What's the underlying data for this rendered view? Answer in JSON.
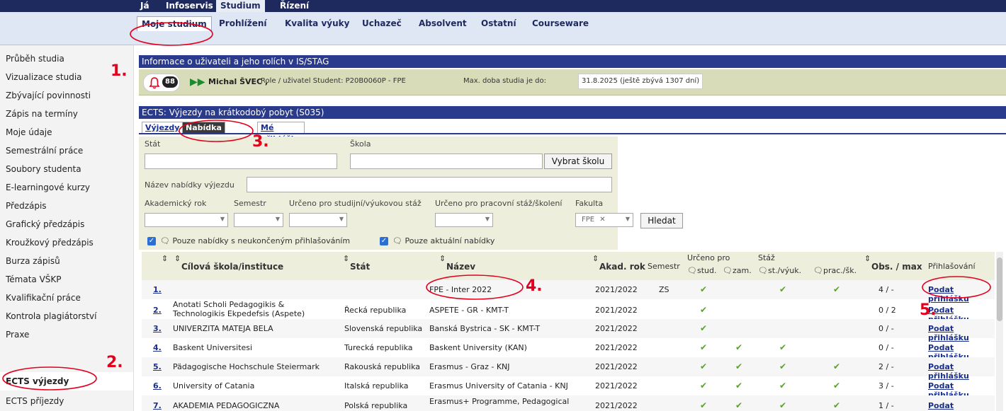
{
  "topnav": {
    "tabs": [
      "Já",
      "Infoservis",
      "Studium",
      "Řízení"
    ]
  },
  "subnav": {
    "items": [
      "Moje studium",
      "Prohlížení",
      "Kvalita výuky",
      "Uchazeč",
      "Absolvent",
      "Ostatní",
      "Courseware"
    ]
  },
  "sidebar": {
    "items": [
      "Průběh studia",
      "Vizualizace studia",
      "Zbývající povinnosti",
      "Zápis na termíny",
      "Moje údaje",
      "Semestrální práce",
      "Soubory studenta",
      "E-learningové kurzy",
      "Předzápis",
      "Grafický předzápis",
      "Kroužkový předzápis",
      "Burza zápisů",
      "Témata VŠKP",
      "Kvalifikační práce",
      "Kontrola plagiátorství",
      "Praxe",
      "ECTS výjezdy",
      "ECTS příjezdy"
    ]
  },
  "info": {
    "bar_title": "Informace o uživateli a jeho rolích v IS/STAG",
    "badge": "88",
    "user": "Michal ŠVEC ,",
    "role": "Role / uživatel Student: P20B0060P - FPE",
    "max_label": "Max. doba studia je do:",
    "max_value": "31.8.2025 (ještě zbývá 1307 dní)"
  },
  "ects": {
    "bar_title": "ECTS: Výjezdy na krátkodobý pobyt (S035)",
    "tabs": [
      "Výjezdy",
      "Nabídka výjezdů",
      "Mé přihlášky na výjezdy"
    ]
  },
  "filter": {
    "stat_label": "Stát",
    "skola_label": "Škola",
    "vybrat_btn": "Vybrat školu",
    "nazev_label": "Název nabídky výjezdu",
    "akad_label": "Akademický rok",
    "semestr_label": "Semestr",
    "urceno_stud_label": "Určeno pro studijní/výukovou stáž",
    "urceno_prac_label": "Určeno pro pracovní stáž/školení",
    "fakulta_label": "Fakulta",
    "fakulta_value": "FPE",
    "hledat_btn": "Hledat",
    "chk1": "Pouze nabídky s neukončeným přihlašováním",
    "chk2": "Pouze aktuální nabídky"
  },
  "table": {
    "headers": {
      "skola": "Cílová škola/instituce",
      "stat": "Stát",
      "nazev": "Název",
      "akad": "Akad. rok",
      "semestr": "Semestr",
      "urceno": "Určeno pro",
      "stud": "stud.",
      "zam": "zam.",
      "staz": "Stáž",
      "styuk": "st./výuk.",
      "prac": "prac./šk.",
      "obs": "Obs. / max",
      "prihl": "Přihlašování"
    },
    "rows": [
      {
        "n": "1.",
        "skola": "",
        "stat": "",
        "nazev": "FPE - Inter 2022",
        "rok": "2021/2022",
        "sem": "ZS",
        "obs": "4 / -",
        "apply": "Podat přihlášku"
      },
      {
        "n": "2.",
        "skola": "Anotati Scholi Pedagogikis & Technologikis Ekpedefsis (Aspete)",
        "stat": "Řecká republika",
        "nazev": "ASPETE - GR - KMT-T",
        "rok": "2021/2022",
        "sem": "",
        "obs": "0 / 2",
        "apply": "Podat přihlášku"
      },
      {
        "n": "3.",
        "skola": "UNIVERZITA MATEJA BELA",
        "stat": "Slovenská republika",
        "nazev": "Banská Bystrica - SK - KMT-T",
        "rok": "2021/2022",
        "sem": "",
        "obs": "0 / -",
        "apply": "Podat přihlášku"
      },
      {
        "n": "4.",
        "skola": "Baskent Universitesi",
        "stat": "Turecká republika",
        "nazev": "Baskent University (KAN)",
        "rok": "2021/2022",
        "sem": "",
        "obs": "0 / -",
        "apply": "Podat přihlášku"
      },
      {
        "n": "5.",
        "skola": "Pädagogische Hochschule Steiermark",
        "stat": "Rakouská republika",
        "nazev": "Erasmus - Graz - KNJ",
        "rok": "2021/2022",
        "sem": "",
        "obs": "2 / -",
        "apply": "Podat přihlášku"
      },
      {
        "n": "6.",
        "skola": "University of Catania",
        "stat": "Italská republika",
        "nazev": "Erasmus University of Catania - KNJ",
        "rok": "2021/2022",
        "sem": "",
        "obs": "3 / -",
        "apply": "Podat přihlášku"
      },
      {
        "n": "7.",
        "skola": "AKADEMIA PEDAGOGICZNA",
        "stat": "Polská republika",
        "nazev": "Erasmus+ Programme, Pedagogical",
        "rok": "2021/2022",
        "sem": "",
        "obs": "1 / -",
        "apply": "Podat přihlášku"
      }
    ]
  },
  "annotations": [
    "1.",
    "2.",
    "3.",
    "4.",
    "5."
  ],
  "colors": {
    "accent": "#2a3a8c",
    "annotation": "#e4001c",
    "check": "#5aa02c"
  }
}
